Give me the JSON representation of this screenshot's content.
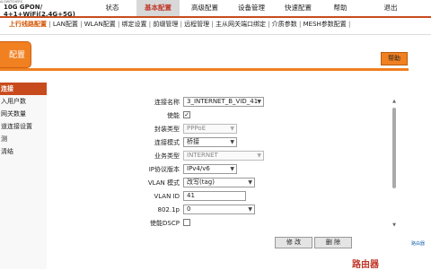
{
  "header": {
    "brand_small": "ALSWITCHERS",
    "model_line1": "10G GPON/",
    "model_line2": "4+1+WiFi(2.4G+5G)"
  },
  "topnav": [
    {
      "label": "状态"
    },
    {
      "label": "基本配置",
      "active": true
    },
    {
      "label": "高级配置"
    },
    {
      "label": "设备管理"
    },
    {
      "label": "快速配置"
    },
    {
      "label": "帮助"
    },
    {
      "label": "退出"
    }
  ],
  "subnav": [
    {
      "label": "上行线路配置",
      "active": true
    },
    {
      "label": "LAN配置"
    },
    {
      "label": "WLAN配置"
    },
    {
      "label": "绑定设置"
    },
    {
      "label": "前缀管理"
    },
    {
      "label": "远程管理"
    },
    {
      "label": "主从网关端口绑定"
    },
    {
      "label": "介质参数"
    },
    {
      "label": "MESH参数配置"
    }
  ],
  "page_tab": "配置",
  "help_label": "帮助",
  "sidebar": [
    {
      "label": "连接",
      "selected": true
    },
    {
      "label": "入用户数"
    },
    {
      "label": "网关数量"
    },
    {
      "label": "道连接设置"
    },
    {
      "label": "测"
    },
    {
      "label": "清结"
    }
  ],
  "form": {
    "conn_name": {
      "label": "连接名称",
      "value": "3_INTERNET_B_VID_41"
    },
    "enable": {
      "label": "使能",
      "checked": true
    },
    "encap": {
      "label": "封装类型",
      "value": "PPPoE",
      "disabled": true
    },
    "mode": {
      "label": "连接模式",
      "value": "桥接"
    },
    "service": {
      "label": "业务类型",
      "value": "INTERNET",
      "disabled": true
    },
    "ipver": {
      "label": "IP协议版本",
      "value": "IPv4/v6"
    },
    "vlan_mode": {
      "label": "VLAN 模式",
      "value": "改写(tag)"
    },
    "vlan_id": {
      "label": "VLAN ID",
      "value": "41"
    },
    "p8021": {
      "label": "802.1p",
      "value": "0"
    },
    "dscp": {
      "label": "使能DSCP",
      "checked": false
    }
  },
  "buttons": {
    "modify": "修 改",
    "delete": "删 除"
  },
  "watermark": {
    "text": "路由器",
    "side": "路由器"
  },
  "colors": {
    "accent": "#c84b1e",
    "tab": "#f08020"
  }
}
